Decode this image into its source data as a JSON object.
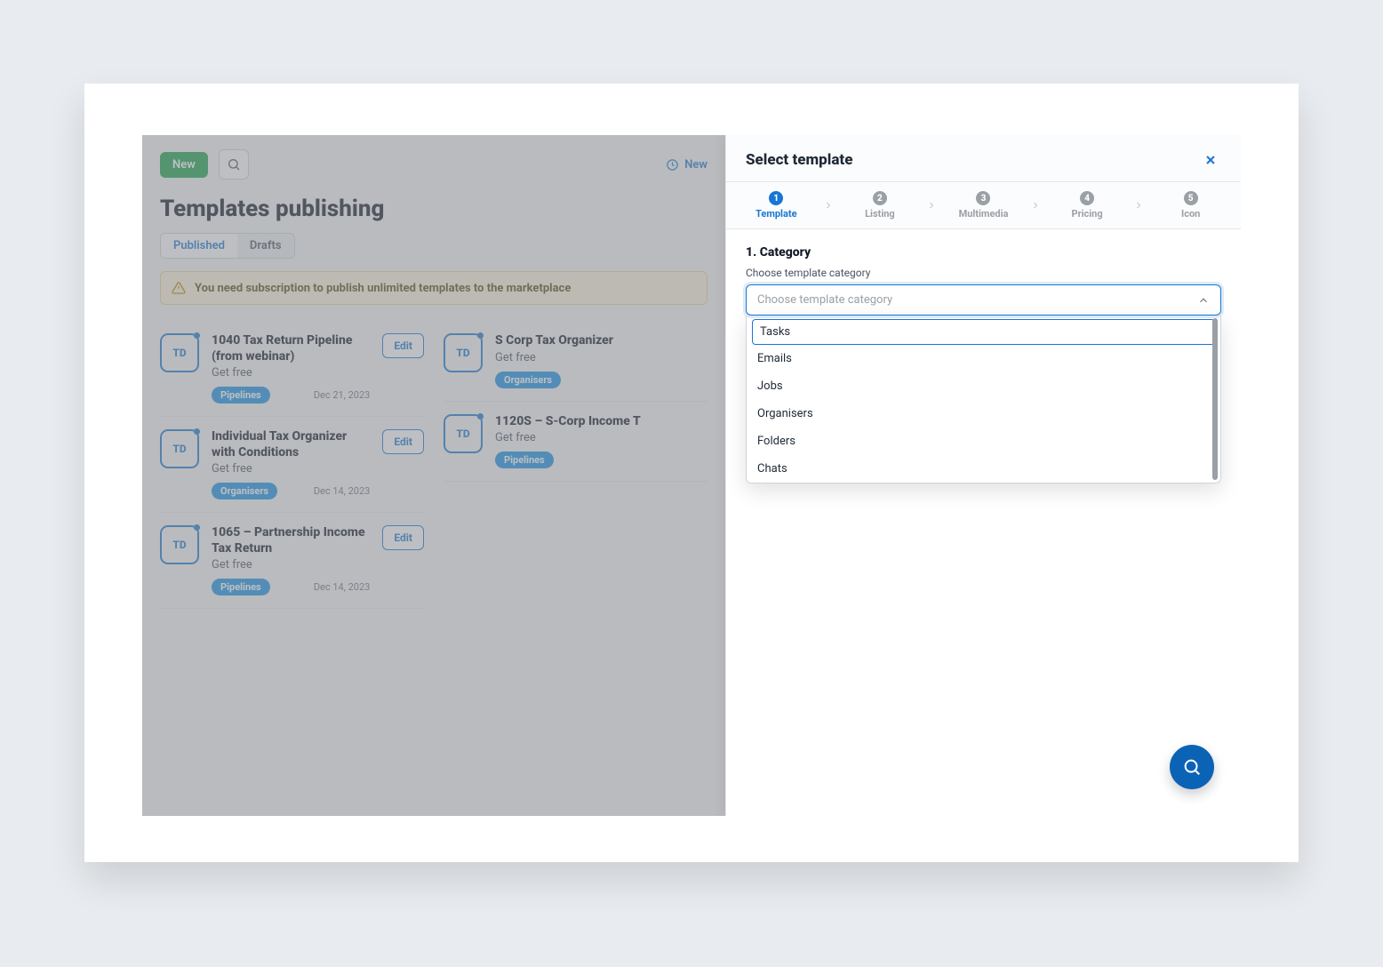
{
  "topbar": {
    "new_label": "New",
    "recent_label": "New"
  },
  "page_title": "Templates publishing",
  "tabs": {
    "published": "Published",
    "drafts": "Drafts"
  },
  "alert_text": "You need subscription to publish unlimited templates to the marketplace",
  "edit_label": "Edit",
  "templates": [
    {
      "title": "1040 Tax Return Pipeline (from webinar)",
      "sub": "Get free",
      "tag": "Pipelines",
      "date": "Dec 21, 2023"
    },
    {
      "title": "S Corp Tax Organizer",
      "sub": "Get free",
      "tag": "Organisers",
      "date": ""
    },
    {
      "title": "Individual Tax Organizer with Conditions",
      "sub": "Get free",
      "tag": "Organisers",
      "date": "Dec 14, 2023"
    },
    {
      "title": "1120S – S-Corp Income T",
      "sub": "Get free",
      "tag": "Pipelines",
      "date": ""
    },
    {
      "title": "1065 – Partnership Income Tax Return",
      "sub": "Get free",
      "tag": "Pipelines",
      "date": "Dec 14, 2023"
    }
  ],
  "panel": {
    "title": "Select template",
    "steps": [
      {
        "num": "1",
        "label": "Template",
        "active": true
      },
      {
        "num": "2",
        "label": "Listing",
        "active": false
      },
      {
        "num": "3",
        "label": "Multimedia",
        "active": false
      },
      {
        "num": "4",
        "label": "Pricing",
        "active": false
      },
      {
        "num": "5",
        "label": "Icon",
        "active": false
      }
    ],
    "section_heading": "1. Category",
    "field_label": "Choose template category",
    "placeholder": "Choose template category",
    "options": [
      "Tasks",
      "Emails",
      "Jobs",
      "Organisers",
      "Folders",
      "Chats"
    ]
  },
  "icons": {
    "td": "TD"
  }
}
